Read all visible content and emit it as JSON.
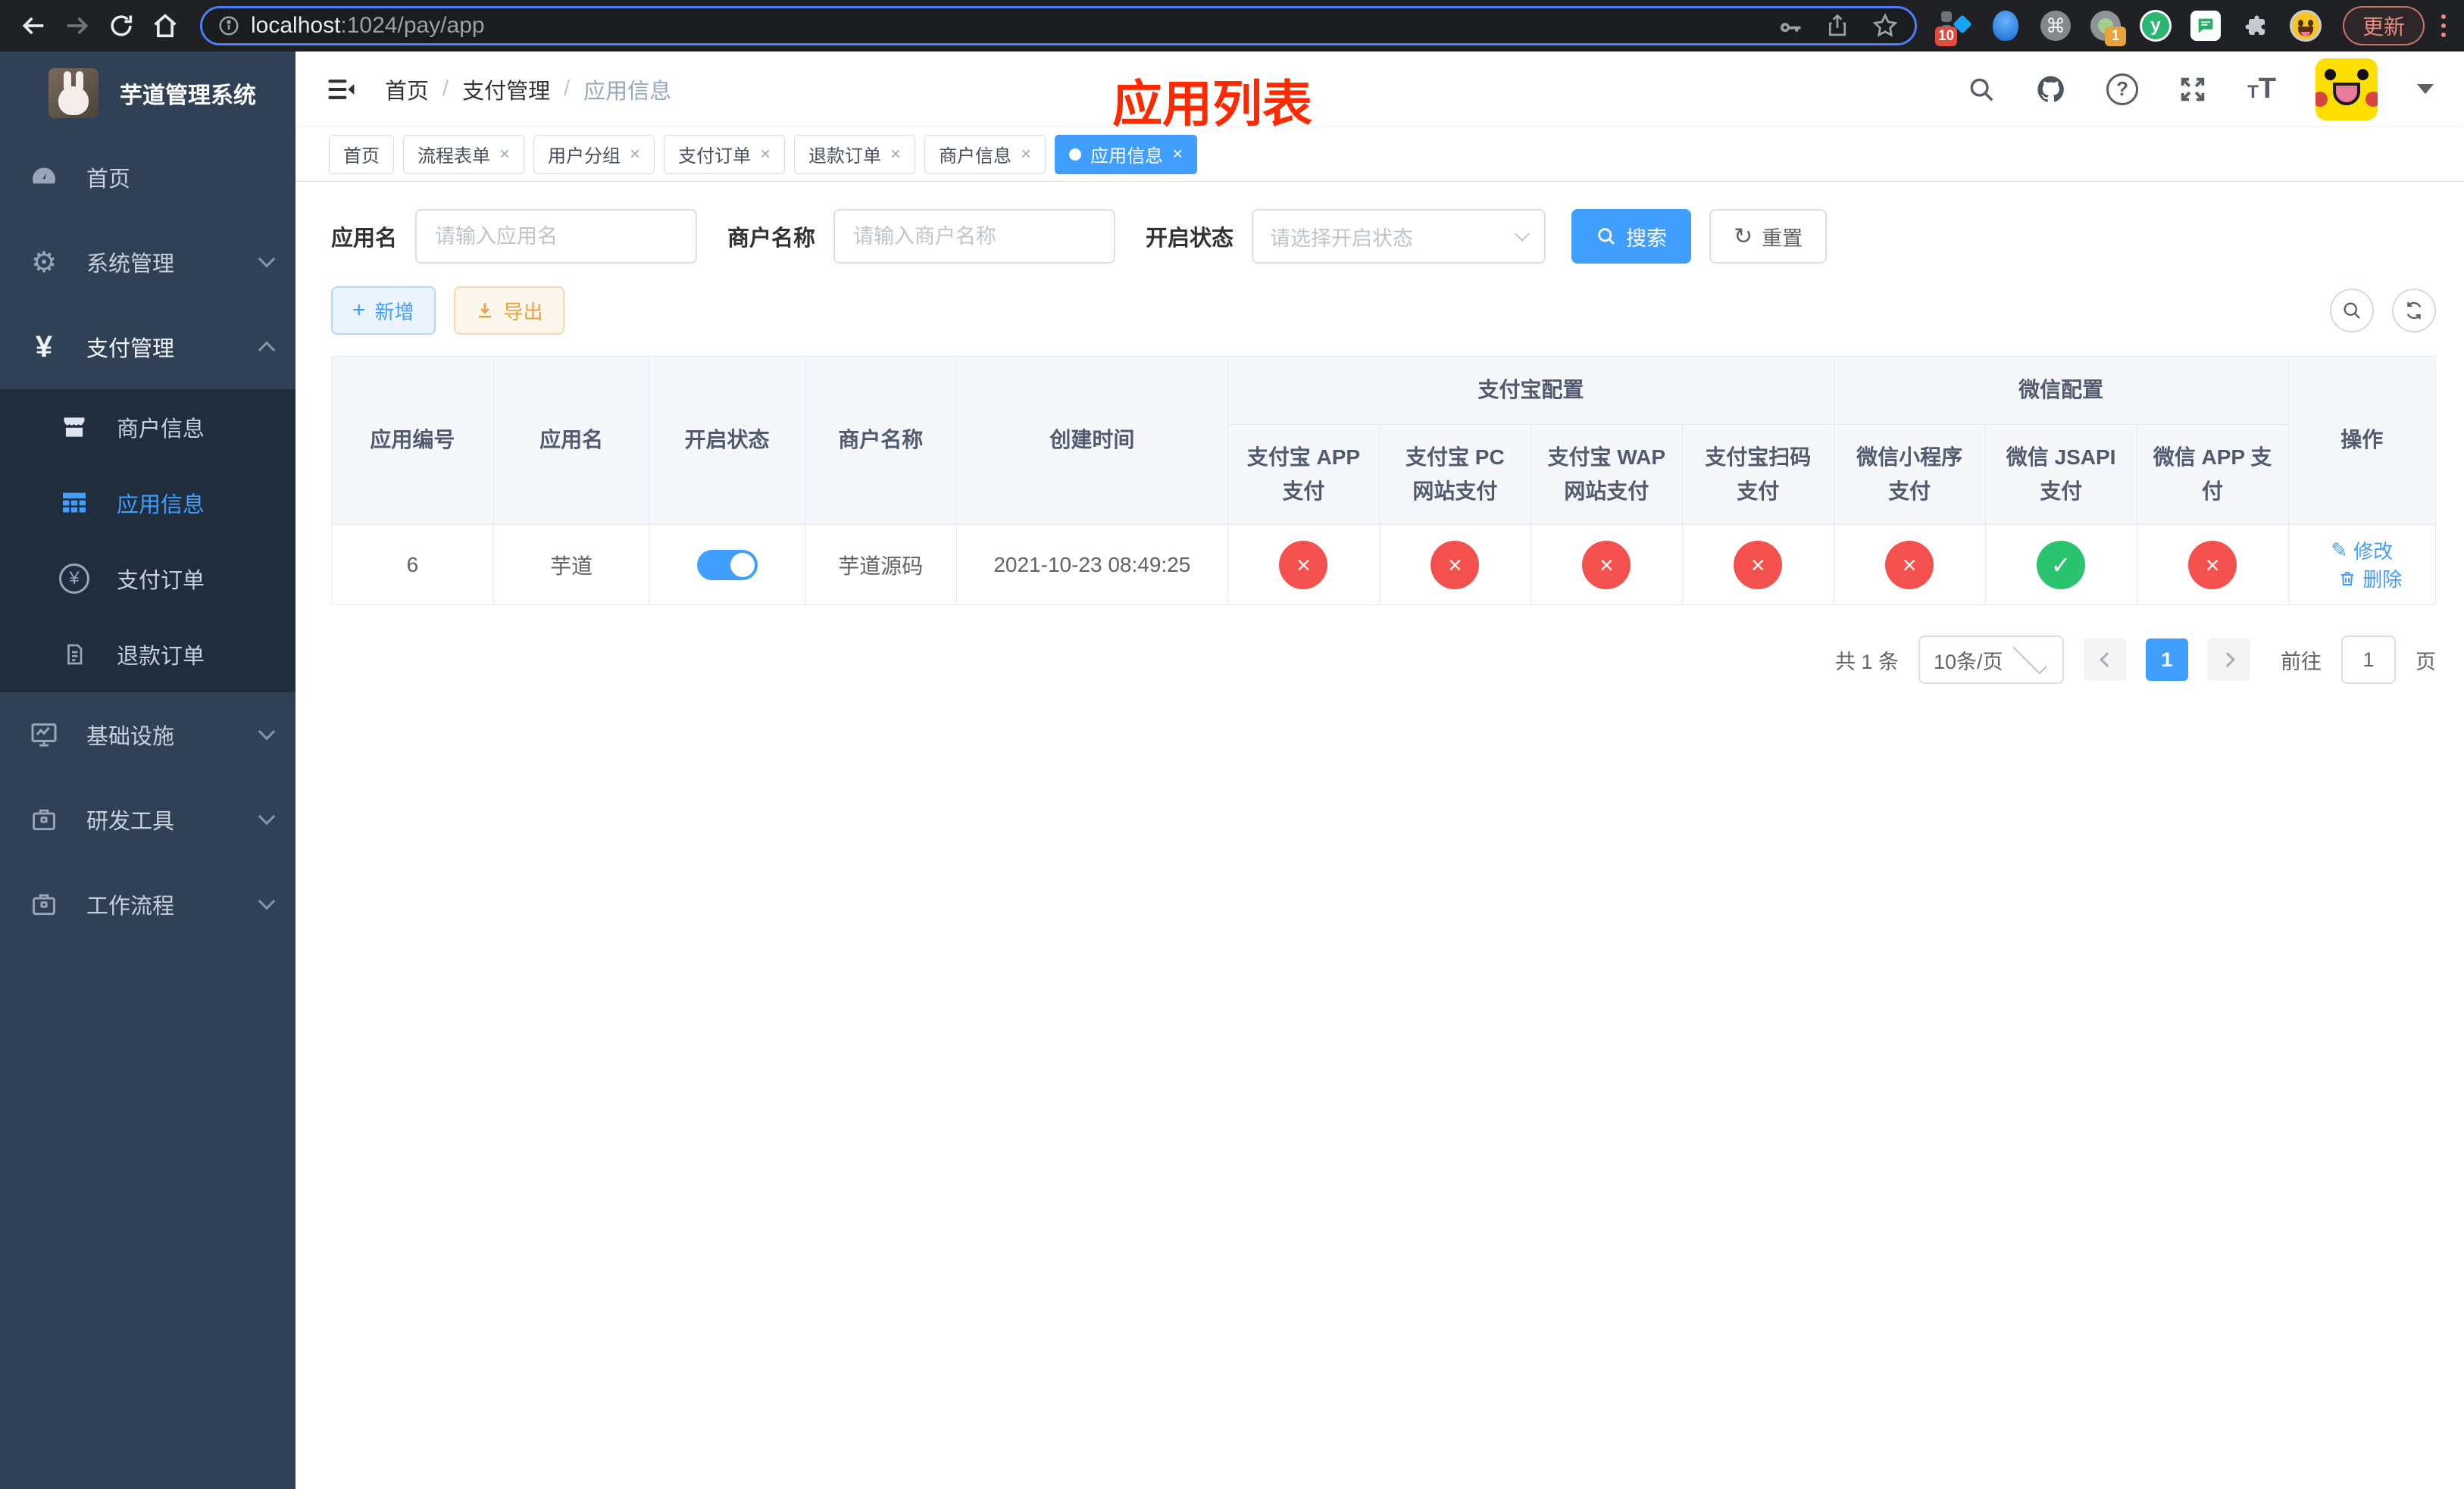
{
  "colors": {
    "accent": "#409EFF",
    "danger": "#F4504D",
    "success": "#2BC46E",
    "warning": "#E6A23C",
    "sidebar-bg": "#304156",
    "submenu-bg": "#1F2D3D",
    "annotation": "#FF2A00"
  },
  "browser": {
    "url": {
      "host": "localhost",
      "rest": ":1024/pay/app"
    },
    "badges": {
      "tampermonkey": "10",
      "note": "1"
    },
    "yuque_letter": "y",
    "command_glyph": "⌘",
    "update_label": "更新"
  },
  "sidebar": {
    "title": "芋道管理系统",
    "menu": [
      {
        "label": "首页"
      },
      {
        "label": "系统管理"
      },
      {
        "label": "支付管理"
      },
      {
        "label": "基础设施"
      },
      {
        "label": "研发工具"
      },
      {
        "label": "工作流程"
      }
    ],
    "submenu": [
      {
        "label": "商户信息"
      },
      {
        "label": "应用信息"
      },
      {
        "label": "支付订单"
      },
      {
        "label": "退款订单"
      }
    ],
    "pay_icon_glyph": "¥",
    "gear_glyph": "⚙"
  },
  "header": {
    "breadcrumb": [
      "首页",
      "支付管理",
      "应用信息"
    ],
    "annotation": "应用列表",
    "help_glyph": "?"
  },
  "tabs": [
    {
      "label": "首页"
    },
    {
      "label": "流程表单"
    },
    {
      "label": "用户分组"
    },
    {
      "label": "支付订单"
    },
    {
      "label": "退款订单"
    },
    {
      "label": "商户信息"
    },
    {
      "label": "应用信息"
    }
  ],
  "tab_close_glyph": "×",
  "filters": {
    "app_name_label": "应用名",
    "app_name_placeholder": "请输入应用名",
    "merchant_label": "商户名称",
    "merchant_placeholder": "请输入商户名称",
    "status_label": "开启状态",
    "status_placeholder": "请选择开启状态",
    "search_label": "搜索",
    "reset_label": "重置",
    "reset_icon": "↻"
  },
  "toolbar": {
    "add_icon": "+",
    "add_label": "新增",
    "export_label": "导出"
  },
  "table": {
    "headers": [
      "应用编号",
      "应用名",
      "开启状态",
      "商户名称",
      "创建时间"
    ],
    "group_alipay": "支付宝配置",
    "group_wechat": "微信配置",
    "sub_headers": [
      "支付宝 APP 支付",
      "支付宝 PC 网站支付",
      "支付宝 WAP 网站支付",
      "支付宝扫码支付",
      "微信小程序支付",
      "微信 JSAPI 支付",
      "微信 APP 支付"
    ],
    "ops_header": "操作",
    "row": {
      "id": "6",
      "name": "芋道",
      "toggle_state": "on",
      "merchant": "芋道源码",
      "created": "2021-10-23 08:49:25",
      "statuses": [
        {
          "state": "fail",
          "glyph": "×"
        },
        {
          "state": "fail",
          "glyph": "×"
        },
        {
          "state": "fail",
          "glyph": "×"
        },
        {
          "state": "fail",
          "glyph": "×"
        },
        {
          "state": "fail",
          "glyph": "×"
        },
        {
          "state": "ok",
          "glyph": "✓"
        },
        {
          "state": "fail",
          "glyph": "×"
        }
      ],
      "edit_icon": "✎",
      "edit_label": "修改",
      "delete_label": "删除"
    }
  },
  "pagination": {
    "total": "共 1 条",
    "page_size": "10条/页",
    "current_page": "1",
    "goto_label": "前往",
    "goto_value": "1",
    "page_suffix": "页"
  }
}
